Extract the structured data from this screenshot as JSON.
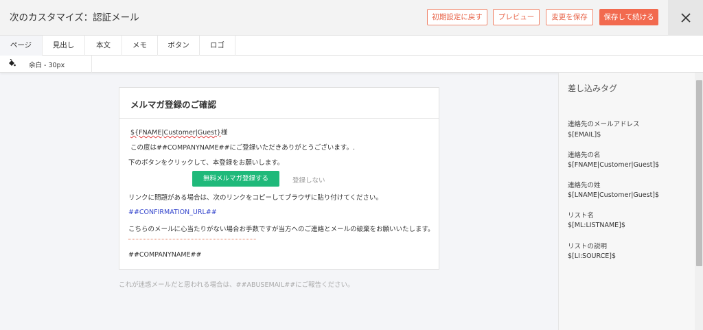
{
  "header": {
    "title": "次のカスタマイズ：認証メール",
    "reset_label": "初期設定に戻す",
    "preview_label": "プレビュー",
    "save_label": "変更を保存",
    "save_continue_label": "保存して続ける"
  },
  "tabs": [
    {
      "label": "ページ",
      "active": true
    },
    {
      "label": "見出し"
    },
    {
      "label": "本文"
    },
    {
      "label": "メモ"
    },
    {
      "label": "ボタン"
    },
    {
      "label": "ロゴ"
    }
  ],
  "subbar": {
    "margin_label": "余白 - 30px"
  },
  "email": {
    "heading": "メルマガ登録のご確認",
    "fname_tag": "${FNAME|Customer|Guest}",
    "honorific": "様",
    "line1": "この度は##COMPANYNAME##にご登録いただきありがとうございます。.",
    "line2": "下のボタンをクリックして、本登録をお願いします。",
    "cta_label": "無料メルマガ登録する",
    "skip_label": "登録しない",
    "line3": "リンクに問題がある場合は、次のリンクをコピーしてブラウザに貼り付けてください。",
    "confirmation_url": "##CONFIRMATION_URL##",
    "line4": "こちらのメールに心当たりがない場合お手数ですが当方へのご連絡とメールの破棄をお願いいたします。",
    "company": "##COMPANYNAME##",
    "abuse_note": "これが迷惑メールだと思われる場合は、##ABUSEMAIL##にご報告ください。"
  },
  "merge_tags": {
    "title": "差し込みタグ",
    "items": [
      {
        "label": "連絡先のメールアドレス",
        "value": "$[EMAIL]$"
      },
      {
        "label": "連絡先の名",
        "value": "$[FNAME|Customer|Guest]$"
      },
      {
        "label": "連絡先の姓",
        "value": "$[LNAME|Customer|Guest]$"
      },
      {
        "label": "リスト名",
        "value": "$[ML:LISTNAME]$"
      },
      {
        "label": "リストの説明",
        "value": "$[LI:SOURCE]$"
      }
    ]
  },
  "colors": {
    "accent": "#f26a4f",
    "cta": "#1fb97a",
    "link": "#3344cc"
  },
  "icons": {
    "close": "close-icon",
    "paint": "paint-bucket-icon"
  }
}
